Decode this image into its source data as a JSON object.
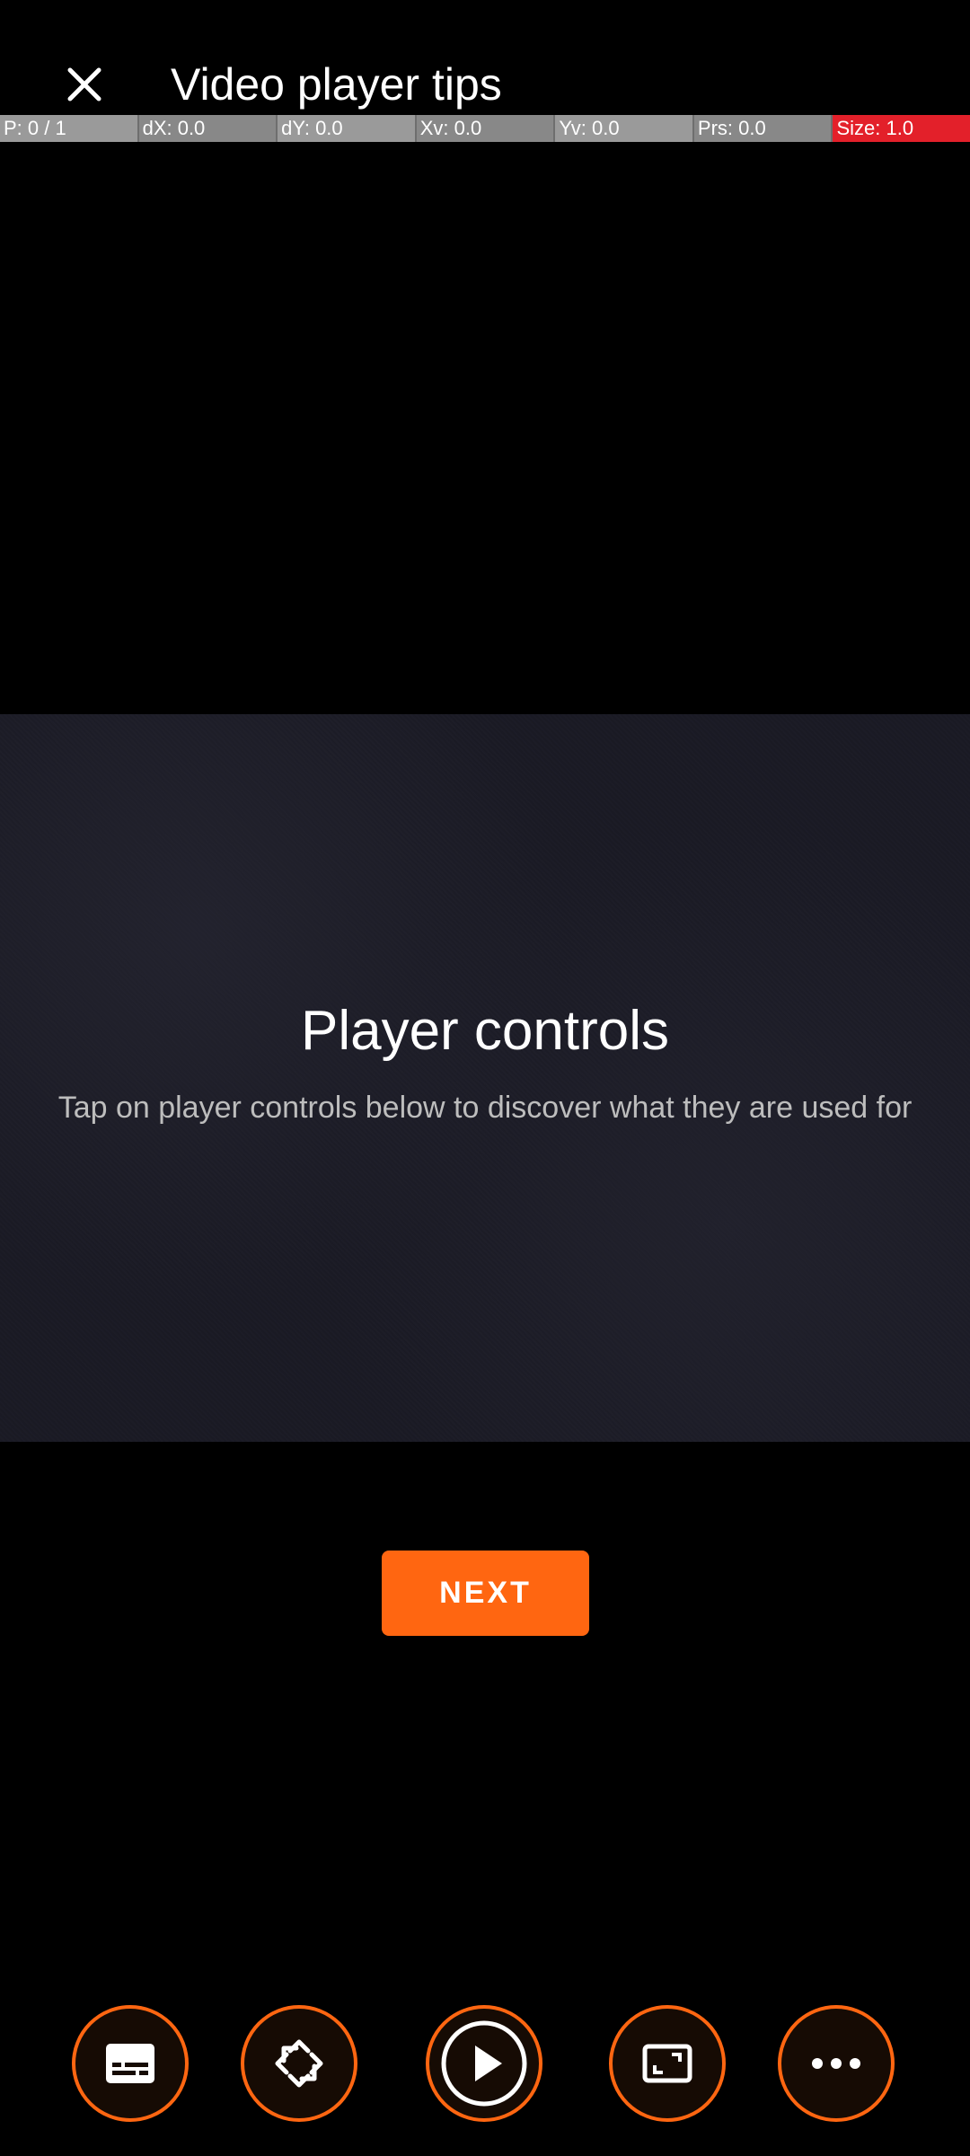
{
  "header": {
    "title": "Video player tips",
    "close_icon": "close-icon"
  },
  "debug_bar": {
    "cells": [
      "P: 0 / 1",
      "dX: 0.0",
      "dY: 0.0",
      "Xv: 0.0",
      "Yv: 0.0",
      "Prs: 0.0",
      "Size: 1.0"
    ],
    "alert_color": "#e3202a"
  },
  "tip": {
    "heading": "Player controls",
    "body": "Tap on player controls below to discover what they are used for"
  },
  "next_button": {
    "label": "NEXT"
  },
  "controls": [
    {
      "name": "subtitles-icon"
    },
    {
      "name": "rotate-screen-icon"
    },
    {
      "name": "play-icon"
    },
    {
      "name": "aspect-ratio-icon"
    },
    {
      "name": "more-options-icon"
    }
  ],
  "colors": {
    "accent": "#ff6611",
    "background": "#000000",
    "text": "#ffffff"
  }
}
